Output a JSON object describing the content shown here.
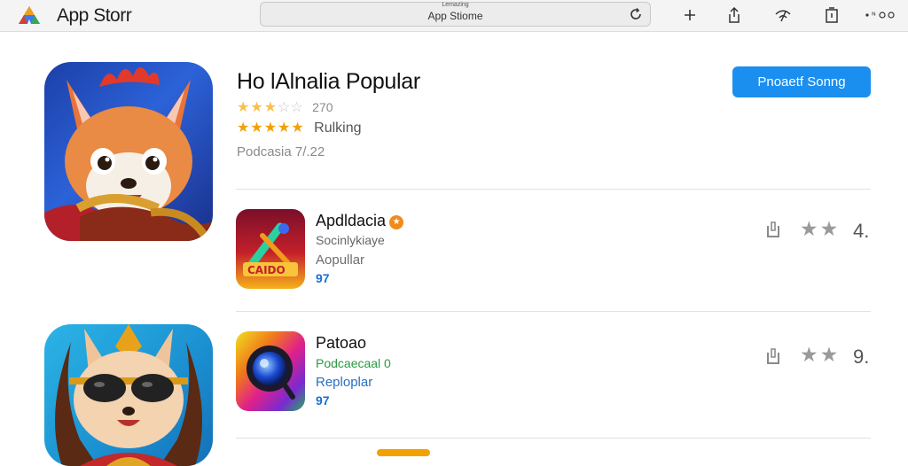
{
  "toolbar": {
    "app_title": "App Storr",
    "address_sub": "Lemazing",
    "address_text": "App Stiome",
    "icons": [
      "new-tab-plus-icon",
      "share-icon",
      "wifi-icon",
      "tabs-icon",
      "more-icon"
    ]
  },
  "featured": {
    "title": "Ho lAlnalia Popular",
    "rating_count": "270",
    "ranking_label": "Rulking",
    "release": "Podcasia 7/.22",
    "cta_label": "Pnoaetf Sonng"
  },
  "list": [
    {
      "name": "Apdldacia",
      "badge": "★",
      "subtitle": "Socinlykiaye",
      "category": "Aopullar",
      "price": "97",
      "rating": "4."
    },
    {
      "name": "Patoao",
      "badge": "",
      "subtitle": "Podcaecaal 0",
      "category": "Reploplar",
      "price": "97",
      "rating": "9."
    }
  ],
  "colors": {
    "accent": "#1a8ff0",
    "star": "#f2a100",
    "price": "#1a6fd0"
  }
}
